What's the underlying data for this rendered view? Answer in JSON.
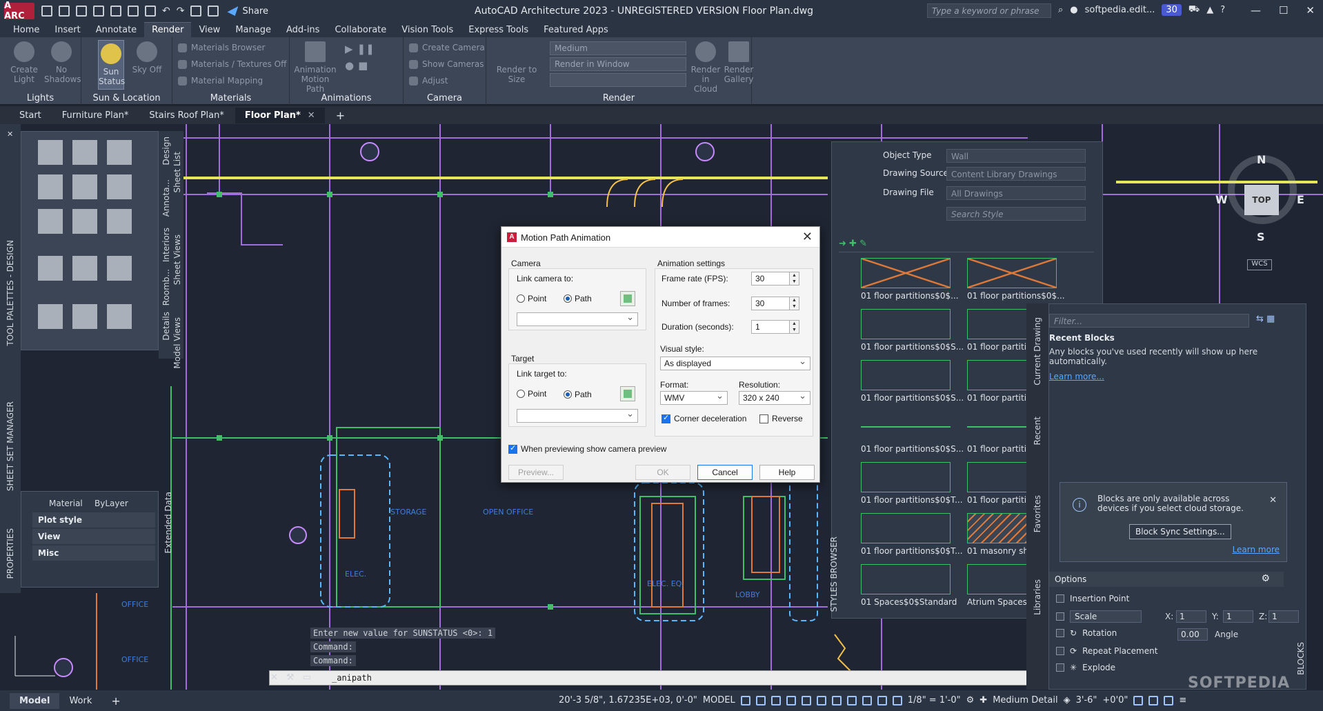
{
  "titlebar": {
    "logo": "A ARC",
    "share": "Share",
    "title": "AutoCAD Architecture 2023 - UNREGISTERED VERSION    Floor Plan.dwg",
    "search_placeholder": "Type a keyword or phrase",
    "user": "softpedia.edit...",
    "badge": "30"
  },
  "ribbon_tabs": [
    "Home",
    "Insert",
    "Annotate",
    "Render",
    "View",
    "Manage",
    "Add-ins",
    "Collaborate",
    "Vision Tools",
    "Express Tools",
    "Featured Apps"
  ],
  "ribbon": {
    "lights": {
      "title": "Lights",
      "create_light": "Create Light",
      "no_shadows": "No Shadows"
    },
    "sun": {
      "title": "Sun & Location",
      "sun_status": "Sun Status",
      "sky_off": "Sky Off"
    },
    "materials": {
      "title": "Materials",
      "browser": "Materials Browser",
      "textures": "Materials / Textures Off",
      "mapping": "Material Mapping"
    },
    "animations": {
      "title": "Animations",
      "motion_path": "Animation Motion Path"
    },
    "camera": {
      "title": "Camera",
      "create": "Create Camera",
      "show": "Show Cameras",
      "adjust": "Adjust"
    },
    "render": {
      "title": "Render",
      "quality": "Medium",
      "target": "Render in Window",
      "render_size": "Render to Size",
      "cloud": "Render in Cloud",
      "gallery": "Render Gallery"
    }
  },
  "file_tabs": [
    "Start",
    "Furniture Plan*",
    "Stairs Roof Plan*",
    "Floor Plan*"
  ],
  "palette_tabs": [
    "Design",
    "Annota...",
    "Interiors",
    "Roomb...",
    "Details"
  ],
  "palette_subtabs": [
    "Sheet List",
    "Sheet Views",
    "Model Views"
  ],
  "left_labels": [
    "TOOL PALETTES - DESIGN",
    "SHEET SET MANAGER",
    "PROPERTIES"
  ],
  "properties": {
    "material_label": "Material",
    "material_value": "ByLayer",
    "sections": [
      "Plot style",
      "View",
      "Misc"
    ],
    "ext_data": "Extended Data"
  },
  "dialog": {
    "title": "Motion Path Animation",
    "camera": {
      "group": "Camera",
      "link_label": "Link camera to:",
      "point": "Point",
      "path": "Path"
    },
    "target": {
      "group": "Target",
      "link_label": "Link target to:",
      "point": "Point",
      "path": "Path"
    },
    "settings": {
      "group": "Animation settings",
      "fps_label": "Frame rate (FPS):",
      "fps": "30",
      "frames_label": "Number of frames:",
      "frames": "30",
      "duration_label": "Duration (seconds):",
      "duration": "1",
      "visual_label": "Visual style:",
      "visual": "As displayed",
      "format_label": "Format:",
      "format": "WMV",
      "res_label": "Resolution:",
      "resolution": "320 x 240",
      "corner": "Corner deceleration",
      "reverse": "Reverse"
    },
    "preview_check": "When previewing show camera preview",
    "preview_btn": "Preview...",
    "ok": "OK",
    "cancel": "Cancel",
    "help": "Help"
  },
  "styles_browser": {
    "object_type_label": "Object Type",
    "object_type": "Wall",
    "source_label": "Drawing Source",
    "source": "Content Library Drawings",
    "file_label": "Drawing File",
    "file": "All Drawings",
    "search": "Search Style",
    "items": [
      "01 floor partitions$0$...",
      "01 floor partitions$0$...",
      "01 floor partitions$0$S...",
      "01 floor partitio",
      "01 floor partitions$0$S...",
      "01 floor partitio",
      "01 floor partitions$0$S...",
      "01 floor partitio",
      "01 floor partitions$0$T...",
      "01 floor partitio",
      "01 floor partitions$0$T...",
      "01 masonry she",
      "01 Spaces$0$Standard",
      "Atrium Spaces$"
    ],
    "vtab": "STYLES BROWSER"
  },
  "blocks": {
    "filter": "Filter...",
    "recent_title": "Recent Blocks",
    "recent_desc": "Any blocks you've used recently will show up here automatically.",
    "learn_more": "Learn more...",
    "note": "Blocks are only available across devices if you select cloud storage.",
    "sync_btn": "Block Sync Settings...",
    "note_learn": "Learn more",
    "options_title": "Options",
    "insertion": "Insertion Point",
    "scale": "Scale",
    "x_label": "X:",
    "x": "1",
    "y_label": "Y:",
    "y": "1",
    "z_label": "Z:",
    "z": "1",
    "rotation": "Rotation",
    "angle": "0.00",
    "angle_label": "Angle",
    "repeat": "Repeat Placement",
    "explode": "Explode",
    "tabs": [
      "Current Drawing",
      "Recent",
      "Favorites",
      "Libraries"
    ],
    "vtab": "BLOCKS"
  },
  "viewcube": {
    "n": "N",
    "s": "S",
    "e": "E",
    "w": "W",
    "top": "TOP",
    "wcs": "WCS"
  },
  "rooms": [
    "STORAGE",
    "OPEN OFFICE",
    "ELEC.",
    "ELEC. EQ.",
    "LOBBY",
    "OFFICE",
    "OFFICE"
  ],
  "command": {
    "history": [
      "Enter new value for SUNSTATUS <0>: 1",
      "Command:",
      "Command:"
    ],
    "current": "_anipath"
  },
  "statusbar": {
    "model": "Model",
    "work": "Work",
    "coords": "20'-3 5/8\", 1.67235E+03, 0'-0\"",
    "model_label": "MODEL",
    "scale": "1/8\" = 1'-0\"",
    "detail": "Medium Detail",
    "elev": "3'-6\"",
    "elev2": "+0'0\""
  },
  "watermark": "SOFTPEDIA",
  "colors": {
    "accent": "#4a5bd1",
    "brand": "#b0203a",
    "wall_yellow": "#e6e65a",
    "line_purple": "#a070d8"
  }
}
